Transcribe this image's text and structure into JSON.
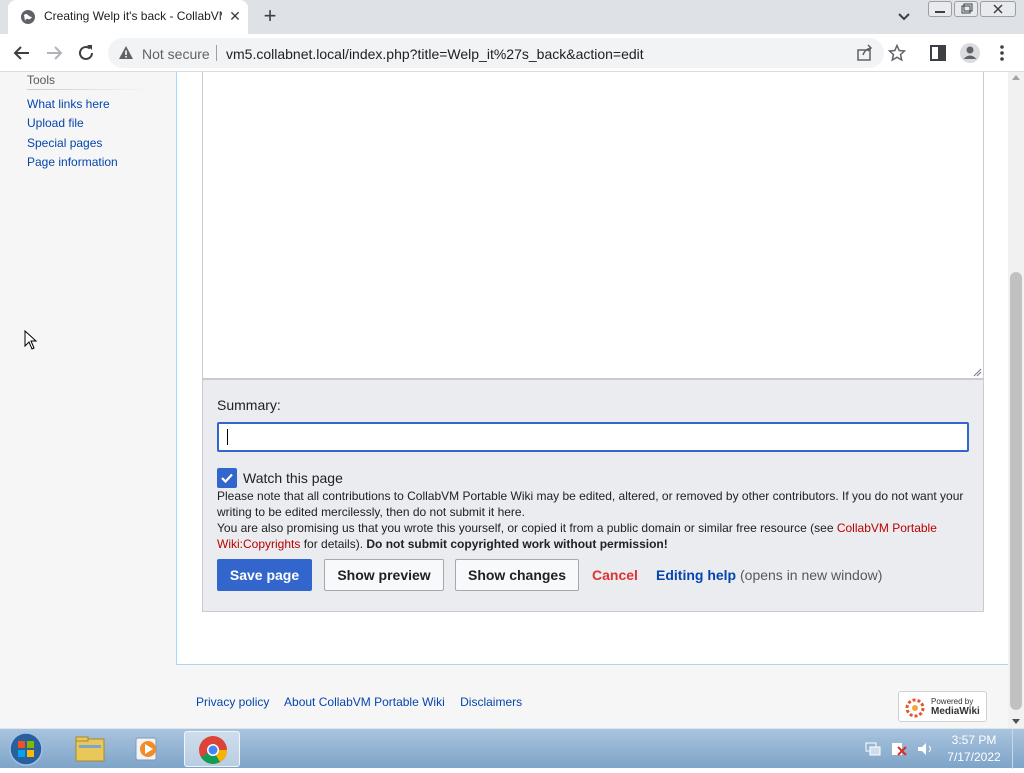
{
  "browser": {
    "tab_title": "Creating Welp it's back - CollabVM",
    "tab_close": "✕",
    "new_tab": "+",
    "security_label": "Not secure",
    "url": "vm5.collabnet.local/index.php?title=Welp_it%27s_back&action=edit"
  },
  "sidebar": {
    "heading": "Tools",
    "links": [
      "What links here",
      "Upload file",
      "Special pages",
      "Page information"
    ]
  },
  "editor": {
    "summary_label": "Summary:",
    "summary_value": "",
    "watch_label": "Watch this page",
    "watch_checked": true,
    "notice_line1": "Please note that all contributions to CollabVM Portable Wiki may be edited, altered, or removed by other contributors. If you do not want your writing to be edited mercilessly, then do not submit it here.",
    "notice_line2_pre": "You are also promising us that you wrote this yourself, or copied it from a public domain or similar free resource (see ",
    "notice_link": "CollabVM Portable Wiki:Copyrights",
    "notice_line2_post": " for details). ",
    "notice_bold": "Do not submit copyrighted work without permission!",
    "save_label": "Save page",
    "preview_label": "Show preview",
    "changes_label": "Show changes",
    "cancel_label": "Cancel",
    "help_label": "Editing help",
    "help_note": "(opens in new window)"
  },
  "footer": {
    "links": [
      "Privacy policy",
      "About CollabVM Portable Wiki",
      "Disclaimers"
    ],
    "powered_line1": "Powered by",
    "powered_line2": "MediaWiki"
  },
  "taskbar": {
    "time": "3:57 PM",
    "date": "7/17/2022"
  },
  "colors": {
    "accent": "#3366cc",
    "link": "#0645ad",
    "cancel": "#dd3333",
    "redlink": "#ba0000"
  }
}
